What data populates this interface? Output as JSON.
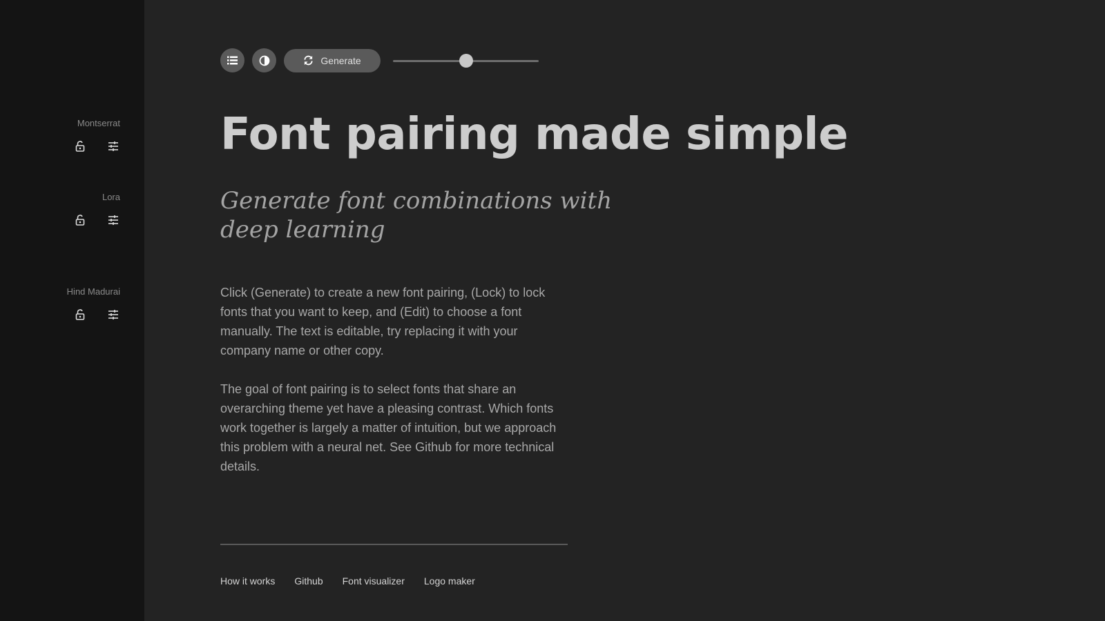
{
  "sidebar": {
    "fonts": [
      {
        "name": "Montserrat",
        "lock_icon": "unlock-icon",
        "edit_icon": "tune-sliders-icon"
      },
      {
        "name": "Lora",
        "lock_icon": "unlock-icon",
        "edit_icon": "tune-sliders-icon"
      },
      {
        "name": "Hind Madurai",
        "lock_icon": "unlock-icon",
        "edit_icon": "tune-sliders-icon"
      }
    ]
  },
  "toolbar": {
    "list_icon": "list-icon",
    "contrast_icon": "contrast-icon",
    "generate_icon": "refresh-icon",
    "generate_label": "Generate",
    "slider_value": 0.5
  },
  "content": {
    "headline": "Font pairing made simple",
    "subheadline": "Generate font combinations with deep learning",
    "paragraph1": "Click (Generate) to create a new font pairing, (Lock) to lock fonts that you want to keep, and (Edit) to choose a font manually. The text is editable, try replacing it with your company name or other copy.",
    "paragraph2": "The goal of font pairing is to select fonts that share an overarching theme yet have a pleasing contrast. Which fonts work together is largely a matter of intuition, but we approach this problem with a neural net. See Github for more technical details."
  },
  "footer": {
    "links": [
      "How it works",
      "Github",
      "Font visualizer",
      "Logo maker"
    ]
  },
  "colors": {
    "background": "#232323",
    "sidebar_background": "#141414",
    "button_background": "#5a5a5a",
    "headline": "#cdcdcd",
    "body_text": "#a8a8a8"
  }
}
